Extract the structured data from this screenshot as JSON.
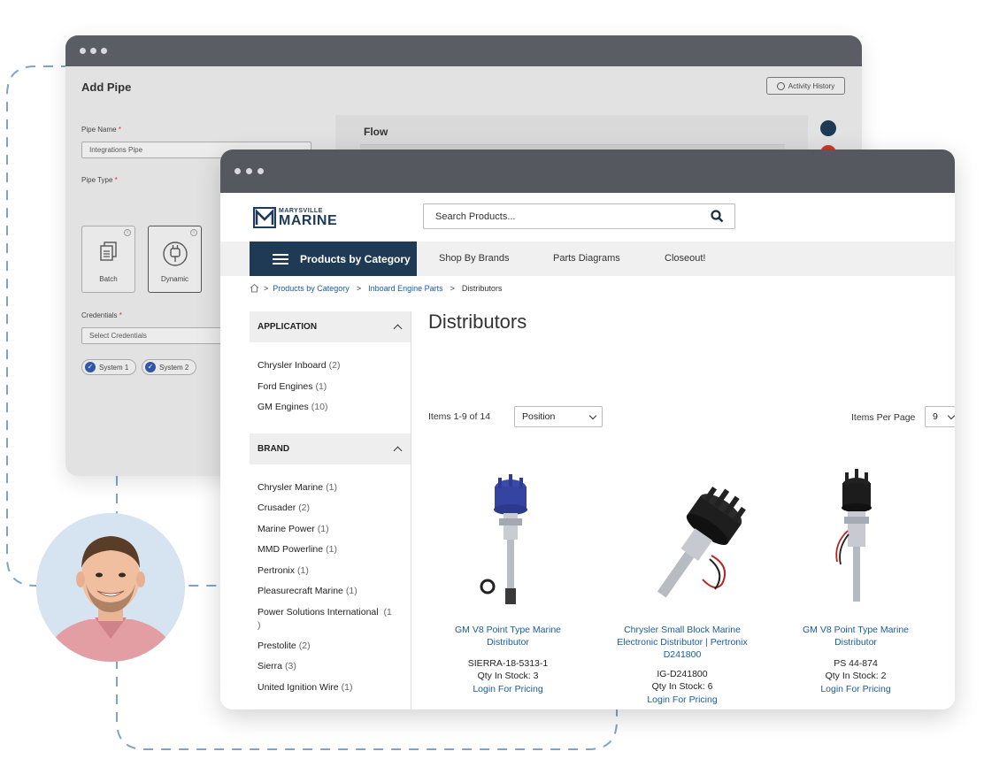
{
  "back_window": {
    "title": "Add Pipe",
    "activity_history": "Activity History",
    "pipe_name_label": "Pipe Name",
    "required_mark": "*",
    "pipe_name_value": "Integrations Pipe",
    "pipe_type_label": "Pipe Type",
    "pipe_types": [
      {
        "name": "Batch",
        "icon": "document-stack-icon",
        "selected": false
      },
      {
        "name": "Dynamic",
        "icon": "plug-icon",
        "selected": true
      }
    ],
    "credentials_label": "Credentials",
    "credentials_placeholder": "Select Credentials",
    "systems": [
      "System 1",
      "System 2"
    ],
    "flow_title": "Flow"
  },
  "store": {
    "logo_top": "MARYSVILLE",
    "logo_bottom": "MARINE",
    "search_placeholder": "Search Products...",
    "nav": {
      "categories": "Products by Category",
      "links": [
        "Shop By Brands",
        "Parts Diagrams",
        "Closeout!"
      ]
    },
    "breadcrumb": {
      "sep": ">",
      "items": [
        "Products by Category",
        "Inboard Engine Parts",
        "Distributors"
      ]
    },
    "sidebar": {
      "application": {
        "title": "APPLICATION",
        "items": [
          {
            "label": "Chrysler Inboard",
            "count": "(2)"
          },
          {
            "label": "Ford Engines",
            "count": "(1)"
          },
          {
            "label": "GM Engines",
            "count": "(10)"
          }
        ]
      },
      "brand": {
        "title": "BRAND",
        "items": [
          {
            "label": "Chrysler Marine",
            "count": "(1)"
          },
          {
            "label": "Crusader",
            "count": "(2)"
          },
          {
            "label": "Marine Power",
            "count": "(1)"
          },
          {
            "label": "MMD Powerline",
            "count": "(1)"
          },
          {
            "label": "Pertronix",
            "count": "(1)"
          },
          {
            "label": "Pleasurecraft Marine",
            "count": "(1)"
          },
          {
            "label": "Power Solutions International",
            "count": "(1\n)"
          },
          {
            "label": "Prestolite",
            "count": "(2)"
          },
          {
            "label": "Sierra",
            "count": "(3)"
          },
          {
            "label": "United Ignition Wire",
            "count": "(1)"
          }
        ]
      }
    },
    "main": {
      "title": "Distributors",
      "items_count": "Items 1-9 of 14",
      "sort_value": "Position",
      "items_per_page_label": "Items Per Page",
      "items_per_page_value": "9"
    },
    "products": [
      {
        "name": "GM V8 Point Type Marine Distributor",
        "sku": "SIERRA-18-5313-1",
        "stock": "Qty In Stock: 3",
        "price": "Login For Pricing"
      },
      {
        "name": "Chrysler Small Block Marine Electronic Distributor | Pertronix D241800",
        "sku": "IG-D241800",
        "stock": "Qty In Stock: 6",
        "price": "Login For Pricing"
      },
      {
        "name": "GM V8 Point Type Marine Distributor",
        "sku": "PS 44-874",
        "stock": "Qty In Stock: 2",
        "price": "Login For Pricing"
      }
    ]
  },
  "colors": {
    "nav_dark": "#1f3a55",
    "link_blue": "#1a5b9c",
    "dash_blue": "#7fa3c8",
    "titlebar": "#55585e"
  }
}
